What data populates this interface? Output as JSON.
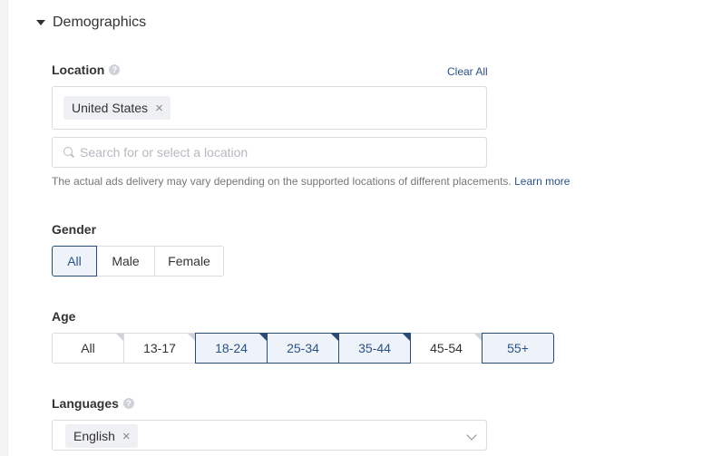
{
  "section": {
    "title": "Demographics"
  },
  "location": {
    "label": "Location",
    "clear_all": "Clear All",
    "selected": [
      "United States"
    ],
    "search_placeholder": "Search for or select a location",
    "hint": "The actual ads delivery may vary depending on the supported locations of different placements.",
    "learn_more": "Learn more"
  },
  "gender": {
    "label": "Gender",
    "options": [
      {
        "label": "All",
        "active": true
      },
      {
        "label": "Male",
        "active": false
      },
      {
        "label": "Female",
        "active": false
      }
    ]
  },
  "age": {
    "label": "Age",
    "options": [
      {
        "label": "All",
        "active": false
      },
      {
        "label": "13-17",
        "active": false
      },
      {
        "label": "18-24",
        "active": true
      },
      {
        "label": "25-34",
        "active": true
      },
      {
        "label": "35-44",
        "active": true
      },
      {
        "label": "45-54",
        "active": false
      },
      {
        "label": "55+",
        "active": true
      }
    ]
  },
  "languages": {
    "label": "Languages",
    "selected": [
      "English"
    ]
  },
  "colors": {
    "accent": "#2a5289",
    "active_bg": "#eef3f9",
    "border": "#d9dce1"
  }
}
